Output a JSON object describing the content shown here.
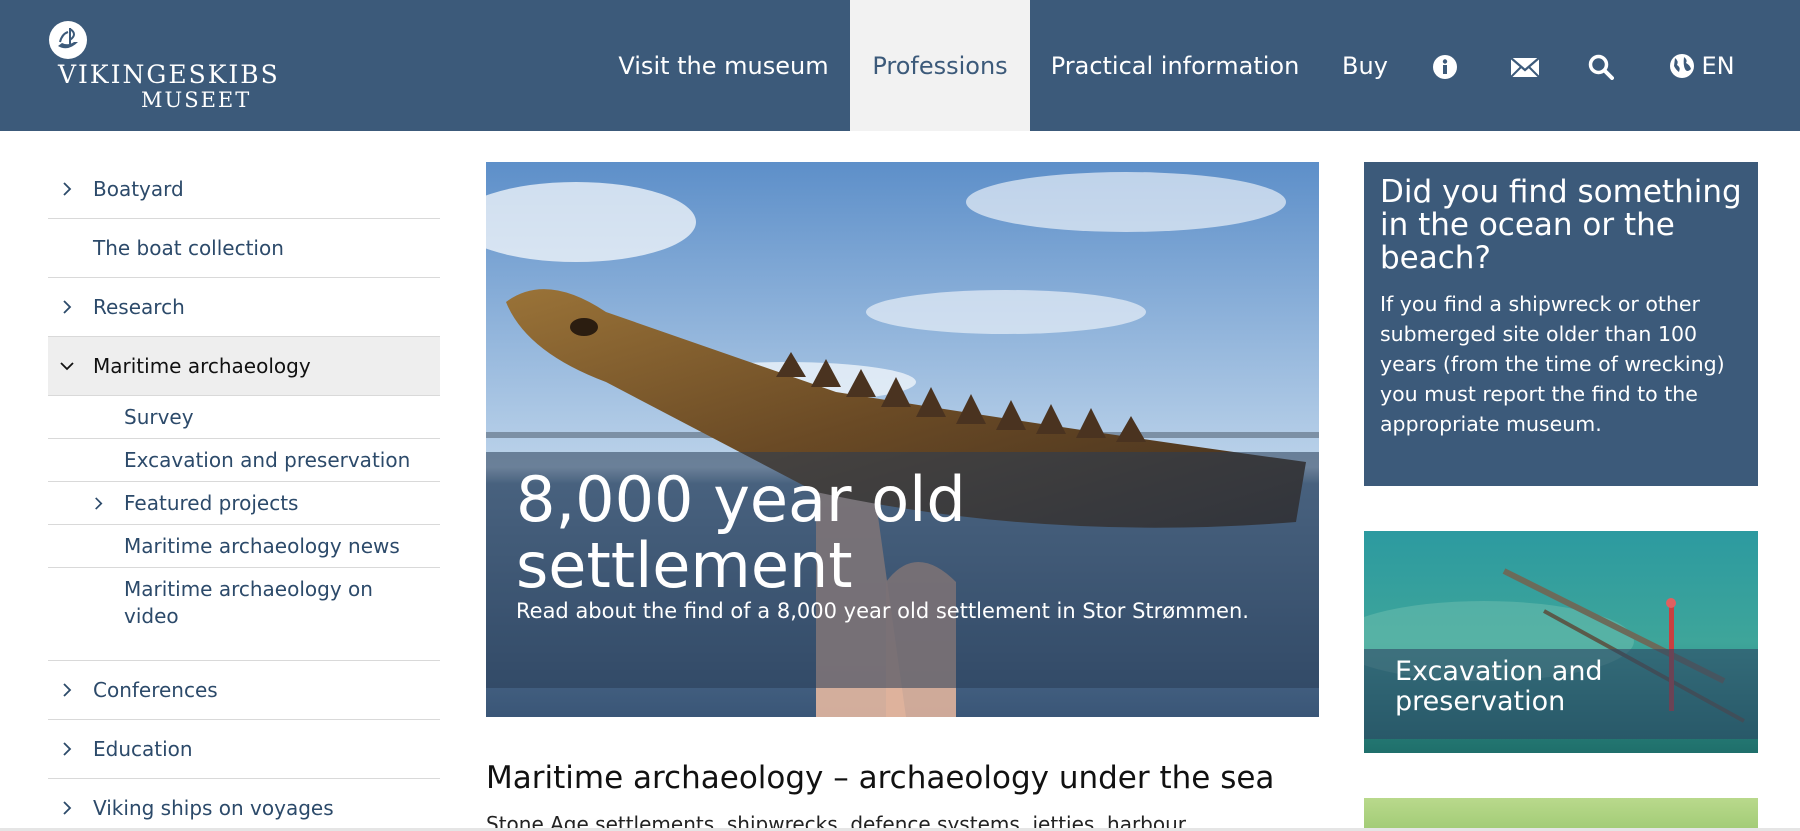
{
  "header": {
    "logo_line1": "VIKINGESKIBS",
    "logo_line2": "MUSEET",
    "nav": [
      {
        "label": "Visit the museum"
      },
      {
        "label": "Professions"
      },
      {
        "label": "Practical information"
      },
      {
        "label": "Buy"
      }
    ],
    "language_label": "EN",
    "icons": [
      "info-icon",
      "mail-icon",
      "search-icon",
      "globe-icon"
    ]
  },
  "sidebar": {
    "items": [
      {
        "label": "Boatyard",
        "expandable": true
      },
      {
        "label": "The boat collection",
        "expandable": false
      },
      {
        "label": "Research",
        "expandable": true
      },
      {
        "label": "Maritime archaeology",
        "expandable": true,
        "expanded": true
      },
      {
        "label": "Conferences",
        "expandable": true
      },
      {
        "label": "Education",
        "expandable": true
      },
      {
        "label": "Viking ships on voyages",
        "expandable": true
      }
    ],
    "subitems": [
      {
        "label": "Survey"
      },
      {
        "label": "Excavation and preservation"
      },
      {
        "label": "Featured projects",
        "expandable": true
      },
      {
        "label": "Maritime archaeology news"
      },
      {
        "label": "Maritime archaeology on video"
      }
    ]
  },
  "hero": {
    "title": "8,000 year old settlement",
    "subtitle": "Read about the find of a 8,000 year old settlement in Stor Strømmen."
  },
  "main": {
    "heading": "Maritime archaeology – archaeology under the sea",
    "paragraph_start": "Stone Age settlements, shipwrecks, defence systems, jetties, harbour"
  },
  "infobox": {
    "title": "Did you find something in the ocean or the beach?",
    "text": "If you find a shipwreck or other submerged site older than 100 years (from the time of wrecking) you must report the find to the appropriate museum."
  },
  "teaser": {
    "label": "Excavation and preservation"
  },
  "colors": {
    "header_bg": "#3c5a7a",
    "active_tab_bg": "#f2f2f2",
    "link_text": "#2c4a6a"
  }
}
